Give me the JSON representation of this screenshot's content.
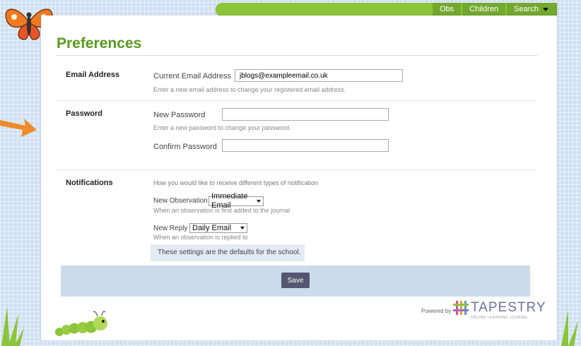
{
  "nav": {
    "items": [
      {
        "label": "Obs"
      },
      {
        "label": "Children"
      },
      {
        "label": "Search"
      }
    ]
  },
  "page": {
    "title": "Preferences"
  },
  "email": {
    "section_label": "Email Address",
    "field_label": "Current Email Address",
    "value": "jblogs@exampleemail.co.uk",
    "help": "Enter a new email address to change your registered email address."
  },
  "password": {
    "section_label": "Password",
    "new_label": "New Password",
    "new_value": "",
    "help": "Enter a new password to change your password.",
    "confirm_label": "Confirm Password",
    "confirm_value": ""
  },
  "notifications": {
    "section_label": "Notifications",
    "intro": "How you would like to receive different types of notification",
    "new_observation": {
      "label": "New Observation",
      "selected": "Immediate Email",
      "help": "When an observation is first added to the journal"
    },
    "new_reply": {
      "label": "New Reply",
      "selected": "Daily Email",
      "help": "When an observation is replied to"
    },
    "defaults_note": "These settings are the defaults for the school."
  },
  "save_label": "Save",
  "footer": {
    "powered_by": "Powered by",
    "brand": "TAPESTRY",
    "brand_tagline": "ONLINE LEARNING JOURNAL"
  },
  "colors": {
    "accent_green": "#8cc43a",
    "title_green": "#5a9b1f",
    "save_button": "#545770",
    "save_bar": "#ccdbea",
    "brand": "#6e72a8"
  },
  "icons": [
    "butterfly-icon",
    "arrow-icon",
    "caterpillar-icon",
    "grass-icon",
    "tapestry-logo-icon",
    "chevron-down-icon"
  ]
}
